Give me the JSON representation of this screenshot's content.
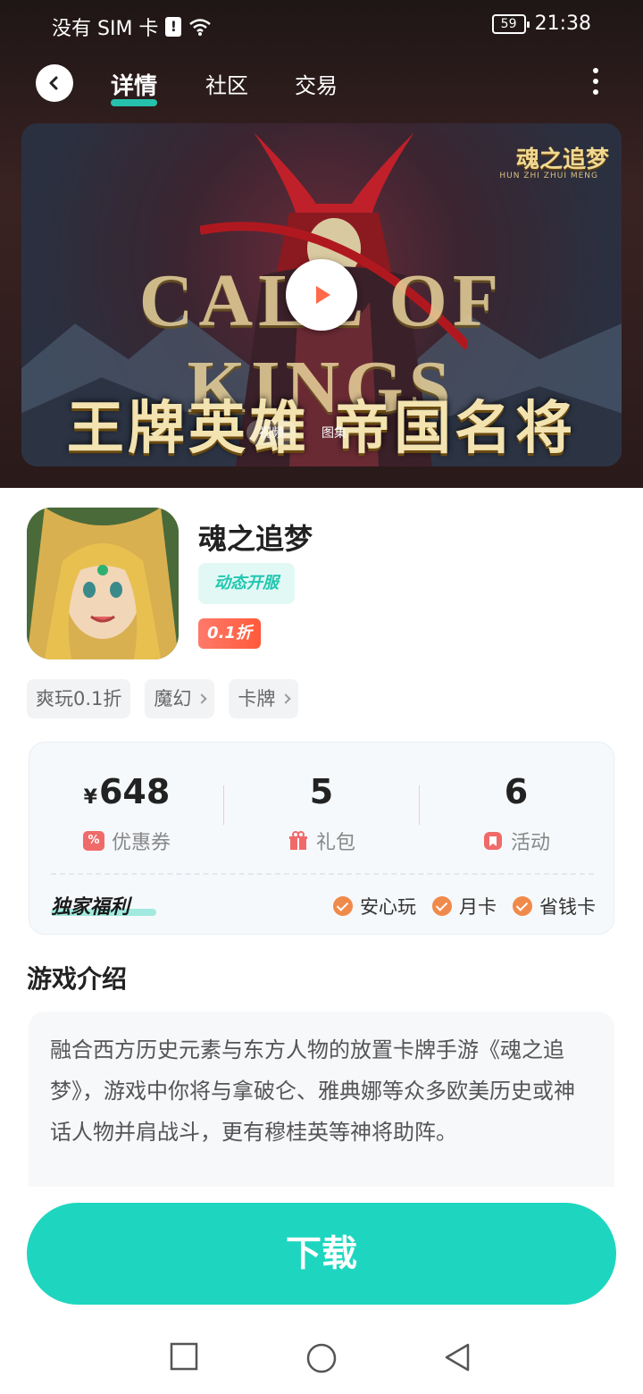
{
  "status_bar": {
    "carrier": "没有 SIM 卡",
    "battery": "59",
    "time": "21:38"
  },
  "nav": {
    "tabs": [
      {
        "label": "详情",
        "active": true
      },
      {
        "label": "社区",
        "active": false
      },
      {
        "label": "交易",
        "active": false
      }
    ],
    "back_icon": "chevron-left-icon",
    "more_icon": "more-vertical-icon"
  },
  "banner": {
    "big_text": "CALL OF KINGS",
    "subtitle": "王牌英雄 帝国名将",
    "logo_text": "魂之追梦",
    "logo_sub": "HUN ZHI ZHUI MENG",
    "media_tabs": [
      {
        "label": "视频",
        "active": true
      },
      {
        "label": "图集",
        "active": false
      }
    ]
  },
  "game": {
    "title": "魂之追梦",
    "tag_dynamic": "动态开服",
    "tag_discount": "0.1折",
    "chips": [
      {
        "label": "爽玩0.1折",
        "has_arrow": false
      },
      {
        "label": "魔幻",
        "has_arrow": true
      },
      {
        "label": "卡牌",
        "has_arrow": true
      }
    ]
  },
  "welfare": {
    "stats": [
      {
        "prefix": "¥",
        "value": "648",
        "label": "优惠券",
        "icon": "coupon-icon"
      },
      {
        "prefix": "",
        "value": "5",
        "label": "礼包",
        "icon": "gift-icon"
      },
      {
        "prefix": "",
        "value": "6",
        "label": "活动",
        "icon": "activity-icon"
      }
    ],
    "exclusive_label": "独家福利",
    "benefits": [
      "安心玩",
      "月卡",
      "省钱卡"
    ]
  },
  "intro": {
    "title": "游戏介绍",
    "text": "融合西方历史元素与东方人物的放置卡牌手游《魂之追梦》，游戏中你将与拿破仑、雅典娜等众多欧美历史或神话人物并肩战斗，更有穆桂英等神将助阵。"
  },
  "download": {
    "label": "下载"
  },
  "colors": {
    "accent": "#1ed6bf",
    "discount": "#ff5a3a",
    "stat_icon": "#f06a6a",
    "benefit_check": "#f08a4a"
  }
}
